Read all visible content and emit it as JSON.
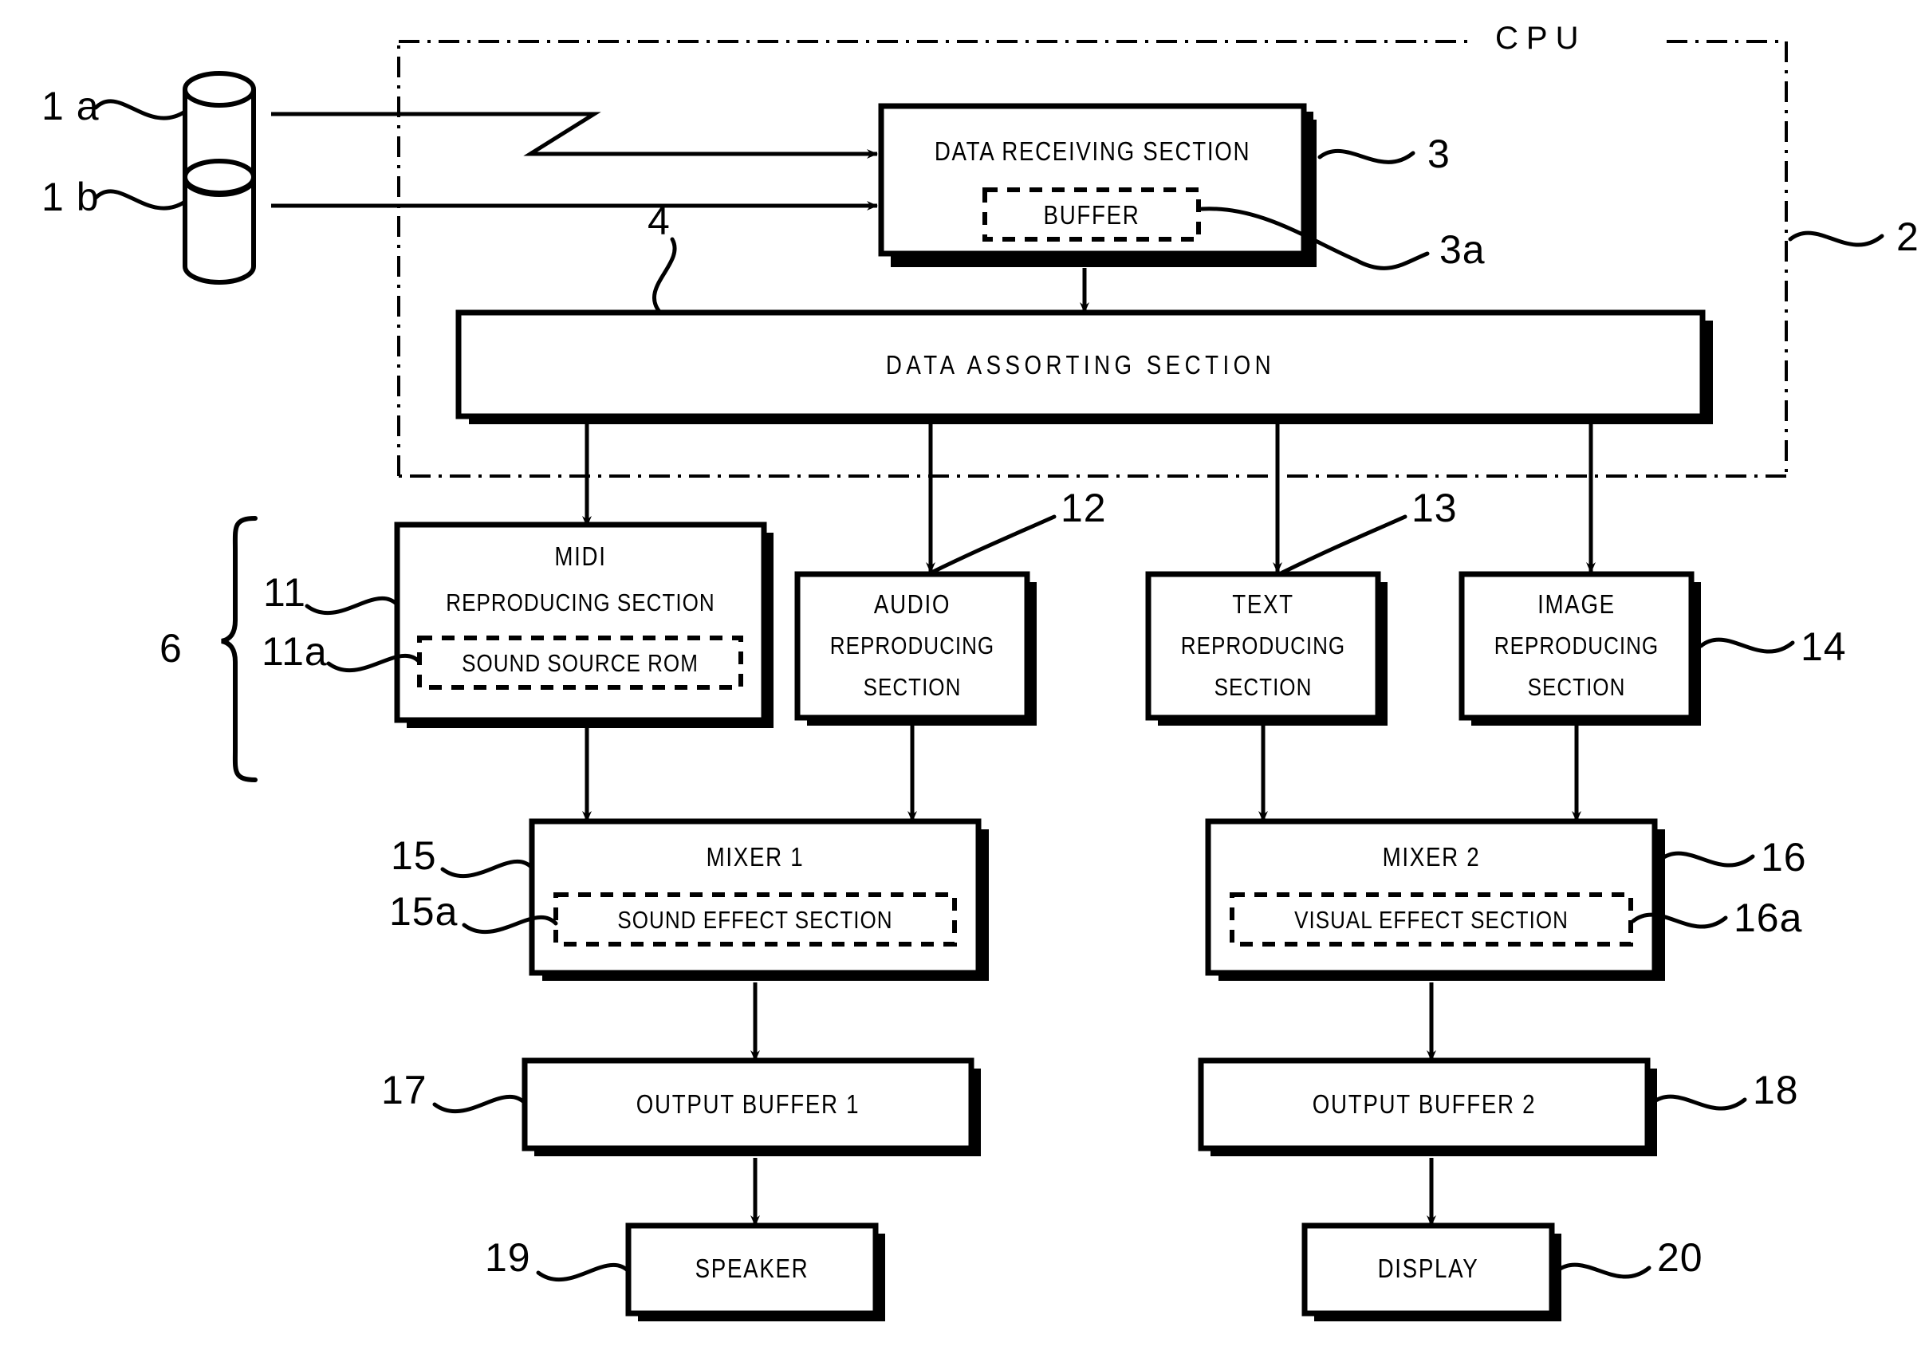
{
  "figure": {
    "title": "CPU data reproducing block diagram",
    "cpu_label": "CPU",
    "line_color": "#000000",
    "background": "#ffffff"
  },
  "sources": [
    {
      "ref": "1 a",
      "name": "data-source-cylinder-a"
    },
    {
      "ref": "1 b",
      "name": "data-source-cylinder-b"
    }
  ],
  "blocks": {
    "data_receiving": {
      "label": "DATA RECEIVING SECTION",
      "ref": "3"
    },
    "buffer": {
      "label": "BUFFER",
      "ref": "3a"
    },
    "data_assorting": {
      "label": "DATA ASSORTING SECTION",
      "ref": "4"
    },
    "midi_reproducing": {
      "label_line1": "MIDI",
      "label_line2": "REPRODUCING SECTION",
      "ref": "11"
    },
    "sound_source_rom": {
      "label": "SOUND SOURCE ROM",
      "ref": "11a"
    },
    "audio_reproducing": {
      "label_line1": "AUDIO",
      "label_line2": "REPRODUCING",
      "label_line3": "SECTION",
      "ref": "12"
    },
    "text_reproducing": {
      "label_line1": "TEXT",
      "label_line2": "REPRODUCING",
      "label_line3": "SECTION",
      "ref": "13"
    },
    "image_reproducing": {
      "label_line1": "IMAGE",
      "label_line2": "REPRODUCING",
      "label_line3": "SECTION",
      "ref": "14"
    },
    "mixer1": {
      "label": "MIXER 1",
      "ref": "15"
    },
    "sound_effect": {
      "label": "SOUND EFFECT SECTION",
      "ref": "15a"
    },
    "mixer2": {
      "label": "MIXER 2",
      "ref": "16"
    },
    "visual_effect": {
      "label": "VISUAL EFFECT SECTION",
      "ref": "16a"
    },
    "output_buffer1": {
      "label": "OUTPUT BUFFER 1",
      "ref": "17"
    },
    "output_buffer2": {
      "label": "OUTPUT BUFFER 2",
      "ref": "18"
    },
    "speaker": {
      "label": "SPEAKER",
      "ref": "19"
    },
    "display": {
      "label": "DISPLAY",
      "ref": "20"
    }
  },
  "group_refs": {
    "reproducing_group": "6",
    "cpu_group": "2"
  }
}
